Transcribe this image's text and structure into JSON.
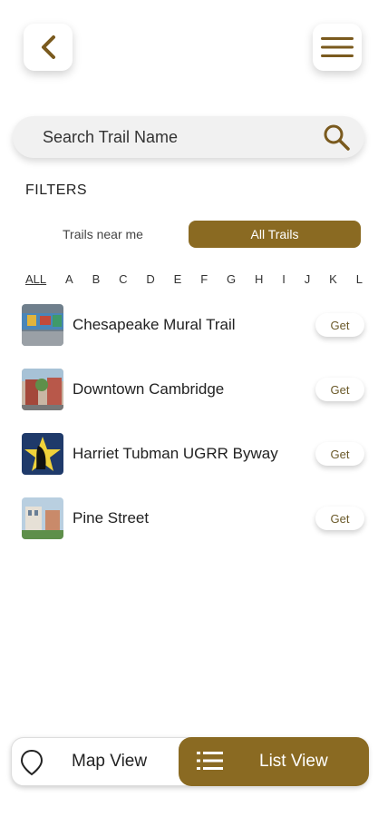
{
  "search": {
    "placeholder": "Search Trail Name"
  },
  "filters": {
    "label": "FILTERS",
    "options": [
      "Trails near me",
      "All Trails"
    ],
    "selected": "All Trails"
  },
  "alphabet": [
    "ALL",
    "A",
    "B",
    "C",
    "D",
    "E",
    "F",
    "G",
    "H",
    "I",
    "J",
    "K",
    "L"
  ],
  "trails": [
    {
      "name": "Chesapeake Mural Trail",
      "action": "Get"
    },
    {
      "name": "Downtown Cambridge",
      "action": "Get"
    },
    {
      "name": "Harriet Tubman UGRR Byway",
      "action": "Get"
    },
    {
      "name": "Pine Street",
      "action": "Get"
    }
  ],
  "bottom_nav": {
    "map_label": "Map View",
    "list_label": "List View",
    "active": "List View"
  },
  "colors": {
    "accent": "#8a6a22",
    "background": "#ffffff"
  },
  "icons": [
    "back-icon",
    "hamburger-menu-icon",
    "search-icon",
    "map-pin-icon",
    "list-icon"
  ]
}
